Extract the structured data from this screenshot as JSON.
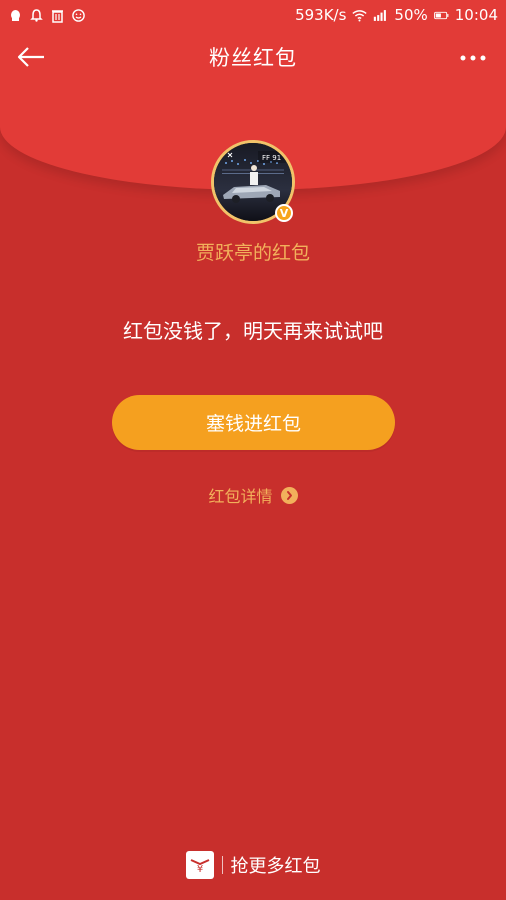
{
  "status_bar": {
    "left_icons": [
      "qq-icon",
      "bell-icon",
      "trash-icon",
      "smile-icon"
    ],
    "network_speed": "593K/s",
    "battery": "50%",
    "time": "10:04"
  },
  "header": {
    "title": "粉丝红包"
  },
  "owner": {
    "avatar_text": "FF 91",
    "verified_badge": "V",
    "name": "贾跃亭的红包"
  },
  "main": {
    "message": "红包没钱了，明天再来试试吧",
    "primary_button": "塞钱进红包",
    "details_link": "红包详情"
  },
  "bottom": {
    "label": "抢更多红包",
    "icon_char": "¥"
  },
  "colors": {
    "page_bg": "#c82f2c",
    "top_bg": "#e23b37",
    "accent": "#f5a01f",
    "gold_text": "#f2b05b"
  }
}
